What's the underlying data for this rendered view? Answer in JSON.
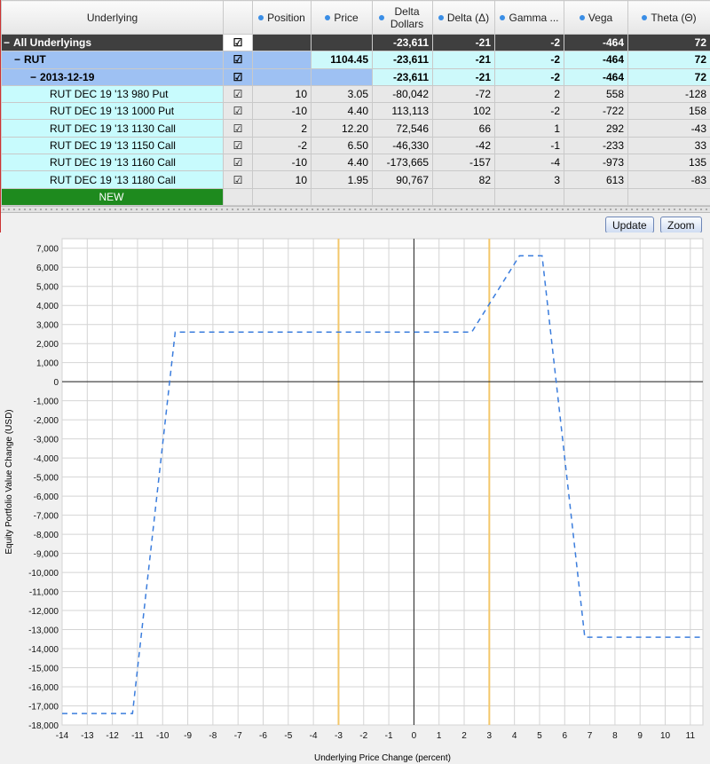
{
  "table": {
    "headers": [
      {
        "label": "Underlying",
        "dot": false
      },
      {
        "label": "",
        "dot": false
      },
      {
        "label": "Position",
        "dot": true
      },
      {
        "label": "Price",
        "dot": true
      },
      {
        "label": "Delta Dollars",
        "dot": true
      },
      {
        "label": "Delta (Δ)",
        "dot": true
      },
      {
        "label": "Gamma ...",
        "dot": true
      },
      {
        "label": "Vega",
        "dot": true
      },
      {
        "label": "Theta (Θ)",
        "dot": true
      }
    ],
    "rows": [
      {
        "kind": "all",
        "toggle": "−",
        "name": "All Underlyings",
        "checked": "☑",
        "position": "",
        "price": "",
        "delta_dollars": "-23,611",
        "delta": "-21",
        "gamma": "-2",
        "vega": "-464",
        "theta": "72"
      },
      {
        "kind": "und",
        "toggle": "−",
        "name": "RUT",
        "checked": "☑",
        "position": "",
        "price": "1104.45",
        "delta_dollars": "-23,611",
        "delta": "-21",
        "gamma": "-2",
        "vega": "-464",
        "theta": "72"
      },
      {
        "kind": "exp",
        "toggle": "−",
        "name": "2013-12-19",
        "checked": "☑",
        "position": "",
        "price": "",
        "delta_dollars": "-23,611",
        "delta": "-21",
        "gamma": "-2",
        "vega": "-464",
        "theta": "72"
      },
      {
        "kind": "leg",
        "toggle": "",
        "name": "RUT DEC 19 '13 980 Put",
        "checked": "☑",
        "position": "10",
        "price": "3.05",
        "delta_dollars": "-80,042",
        "delta": "-72",
        "gamma": "2",
        "vega": "558",
        "theta": "-128"
      },
      {
        "kind": "leg",
        "toggle": "",
        "name": "RUT DEC 19 '13 1000 Put",
        "checked": "☑",
        "position": "-10",
        "price": "4.40",
        "delta_dollars": "113,113",
        "delta": "102",
        "gamma": "-2",
        "vega": "-722",
        "theta": "158"
      },
      {
        "kind": "leg",
        "toggle": "",
        "name": "RUT DEC 19 '13 1130 Call",
        "checked": "☑",
        "position": "2",
        "price": "12.20",
        "delta_dollars": "72,546",
        "delta": "66",
        "gamma": "1",
        "vega": "292",
        "theta": "-43"
      },
      {
        "kind": "leg",
        "toggle": "",
        "name": "RUT DEC 19 '13 1150 Call",
        "checked": "☑",
        "position": "-2",
        "price": "6.50",
        "delta_dollars": "-46,330",
        "delta": "-42",
        "gamma": "-1",
        "vega": "-233",
        "theta": "33"
      },
      {
        "kind": "leg",
        "toggle": "",
        "name": "RUT DEC 19 '13 1160 Call",
        "checked": "☑",
        "position": "-10",
        "price": "4.40",
        "delta_dollars": "-173,665",
        "delta": "-157",
        "gamma": "-4",
        "vega": "-973",
        "theta": "135"
      },
      {
        "kind": "leg",
        "toggle": "",
        "name": "RUT DEC 19 '13 1180 Call",
        "checked": "☑",
        "position": "10",
        "price": "1.95",
        "delta_dollars": "90,767",
        "delta": "82",
        "gamma": "3",
        "vega": "613",
        "theta": "-83"
      },
      {
        "kind": "new",
        "toggle": "",
        "name": "NEW",
        "checked": "",
        "position": "",
        "price": "",
        "delta_dollars": "",
        "delta": "",
        "gamma": "",
        "vega": "",
        "theta": ""
      }
    ]
  },
  "buttons": {
    "update": "Update",
    "zoom": "Zoom"
  },
  "chart_data": {
    "type": "line",
    "xlabel": "Underlying Price Change (percent)",
    "ylabel": "Equity Portfolio Value Change (USD)",
    "xlim": [
      -14,
      11.5
    ],
    "ylim": [
      -18000,
      7500
    ],
    "xticks": [
      -14,
      -13,
      -12,
      -11,
      -10,
      -9,
      -8,
      -7,
      -6,
      -5,
      -4,
      -3,
      -2,
      -1,
      0,
      1,
      2,
      3,
      4,
      5,
      6,
      7,
      8,
      9,
      10,
      11
    ],
    "yticks": [
      7000,
      6000,
      5000,
      4000,
      3000,
      2000,
      1000,
      0,
      -1000,
      -2000,
      -3000,
      -4000,
      -5000,
      -6000,
      -7000,
      -8000,
      -9000,
      -10000,
      -11000,
      -12000,
      -13000,
      -14000,
      -15000,
      -16000,
      -17000,
      -18000
    ],
    "ytick_labels": [
      "7,000",
      "6,000",
      "5,000",
      "4,000",
      "3,000",
      "2,000",
      "1,000",
      "0",
      "-1,000",
      "-2,000",
      "-3,000",
      "-4,000",
      "-5,000",
      "-6,000",
      "-7,000",
      "-8,000",
      "-9,000",
      "-10,000",
      "-11,000",
      "-12,000",
      "-13,000",
      "-14,000",
      "-15,000",
      "-16,000",
      "-17,000",
      "-18,000"
    ],
    "vertical_markers": [
      -3,
      3
    ],
    "marker_color": "#f3c76b",
    "series_color": "#3b7ddd",
    "grid": true,
    "x": [
      -14,
      -11.2,
      -9.5,
      2.3,
      4.2,
      5.1,
      6.8,
      11.5
    ],
    "y": [
      -17400,
      -17400,
      2600,
      2600,
      6600,
      6600,
      -13400,
      -13400
    ]
  }
}
